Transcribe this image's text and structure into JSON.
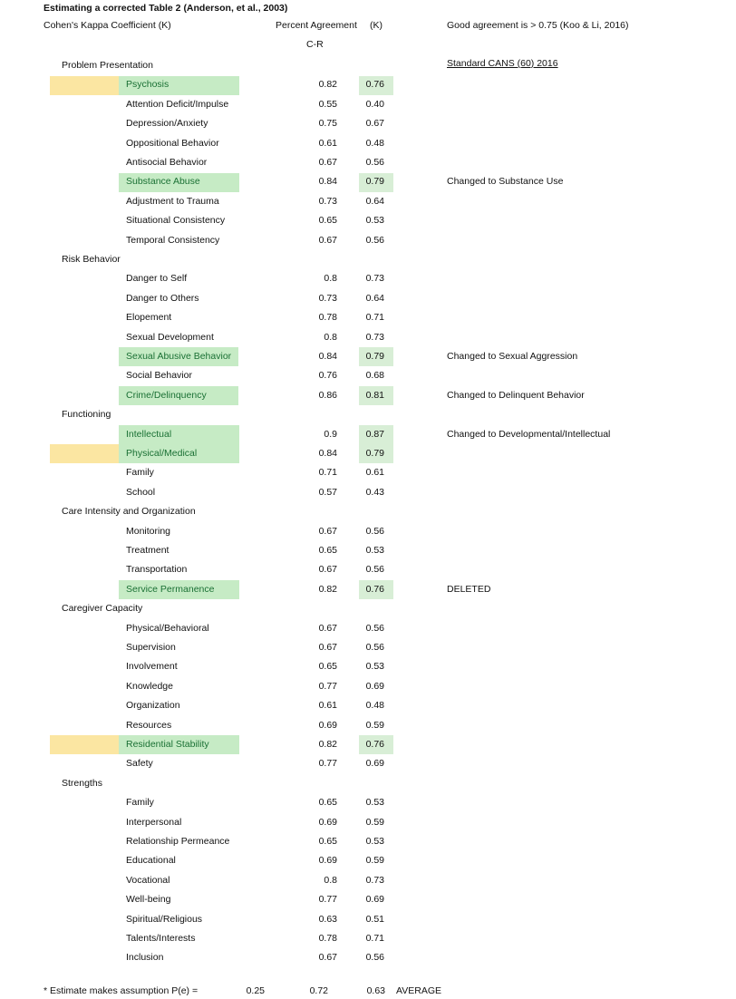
{
  "document": {
    "title": "Estimating a corrected Table 2 (Anderson, et al., 2003)",
    "subtitle": "Cohen's Kappa Coefficient (K)"
  },
  "columns": {
    "percent_agreement": "Percent Agreement",
    "percent_agreement_sub": "C-R",
    "kappa": "(K)"
  },
  "notes": {
    "good_agreement": "Good agreement is > 0.75 (Koo & Li, 2016)",
    "standard_cans": "Standard CANS (60) 2016"
  },
  "footer": {
    "label": "* Estimate makes assumption P(e) =",
    "pe": "0.25",
    "percent_agreement_avg": "0.72",
    "kappa_avg": "0.63",
    "average_label": "AVERAGE"
  },
  "sections": [
    {
      "name": "Problem Presentation",
      "rows": [
        {
          "label": "Psychosis",
          "pa": "0.82",
          "k": "0.76",
          "note": "",
          "highlight": "green",
          "yellow": true
        },
        {
          "label": "Attention Deficit/Impulse",
          "pa": "0.55",
          "k": "0.40",
          "note": "",
          "highlight": "none",
          "yellow": false
        },
        {
          "label": "Depression/Anxiety",
          "pa": "0.75",
          "k": "0.67",
          "note": "",
          "highlight": "none",
          "yellow": false
        },
        {
          "label": "Oppositional Behavior",
          "pa": "0.61",
          "k": "0.48",
          "note": "",
          "highlight": "none",
          "yellow": false
        },
        {
          "label": "Antisocial Behavior",
          "pa": "0.67",
          "k": "0.56",
          "note": "",
          "highlight": "none",
          "yellow": false
        },
        {
          "label": "Substance Abuse",
          "pa": "0.84",
          "k": "0.79",
          "note": "Changed to Substance Use",
          "highlight": "green",
          "yellow": false
        },
        {
          "label": "Adjustment to Trauma",
          "pa": "0.73",
          "k": "0.64",
          "note": "",
          "highlight": "none",
          "yellow": false
        },
        {
          "label": "Situational Consistency",
          "pa": "0.65",
          "k": "0.53",
          "note": "",
          "highlight": "none",
          "yellow": false
        },
        {
          "label": "Temporal Consistency",
          "pa": "0.67",
          "k": "0.56",
          "note": "",
          "highlight": "none",
          "yellow": false
        }
      ]
    },
    {
      "name": "Risk Behavior",
      "rows": [
        {
          "label": "Danger to Self",
          "pa": "0.8",
          "k": "0.73",
          "note": "",
          "highlight": "none",
          "yellow": false
        },
        {
          "label": "Danger to Others",
          "pa": "0.73",
          "k": "0.64",
          "note": "",
          "highlight": "none",
          "yellow": false
        },
        {
          "label": "Elopement",
          "pa": "0.78",
          "k": "0.71",
          "note": "",
          "highlight": "none",
          "yellow": false
        },
        {
          "label": "Sexual Development",
          "pa": "0.8",
          "k": "0.73",
          "note": "",
          "highlight": "none",
          "yellow": false
        },
        {
          "label": "Sexual Abusive Behavior",
          "pa": "0.84",
          "k": "0.79",
          "note": "Changed to Sexual Aggression",
          "highlight": "green",
          "yellow": false
        },
        {
          "label": "Social Behavior",
          "pa": "0.76",
          "k": "0.68",
          "note": "",
          "highlight": "none",
          "yellow": false
        },
        {
          "label": "Crime/Delinquency",
          "pa": "0.86",
          "k": "0.81",
          "note": "Changed to Delinquent Behavior",
          "highlight": "green",
          "yellow": false
        }
      ]
    },
    {
      "name": "Functioning",
      "rows": [
        {
          "label": "Intellectual",
          "pa": "0.9",
          "k": "0.87",
          "note": "Changed to Developmental/Intellectual",
          "highlight": "green",
          "yellow": false
        },
        {
          "label": "Physical/Medical",
          "pa": "0.84",
          "k": "0.79",
          "note": "",
          "highlight": "green",
          "yellow": true
        },
        {
          "label": "Family",
          "pa": "0.71",
          "k": "0.61",
          "note": "",
          "highlight": "none",
          "yellow": false
        },
        {
          "label": "School",
          "pa": "0.57",
          "k": "0.43",
          "note": "",
          "highlight": "none",
          "yellow": false
        }
      ]
    },
    {
      "name": "Care Intensity and Organization",
      "rows": [
        {
          "label": "Monitoring",
          "pa": "0.67",
          "k": "0.56",
          "note": "",
          "highlight": "none",
          "yellow": false
        },
        {
          "label": "Treatment",
          "pa": "0.65",
          "k": "0.53",
          "note": "",
          "highlight": "none",
          "yellow": false
        },
        {
          "label": "Transportation",
          "pa": "0.67",
          "k": "0.56",
          "note": "",
          "highlight": "none",
          "yellow": false
        },
        {
          "label": "Service Permanence",
          "pa": "0.82",
          "k": "0.76",
          "note": "DELETED",
          "highlight": "green",
          "yellow": false
        }
      ]
    },
    {
      "name": "Caregiver Capacity",
      "rows": [
        {
          "label": "Physical/Behavioral",
          "pa": "0.67",
          "k": "0.56",
          "note": "",
          "highlight": "none",
          "yellow": false
        },
        {
          "label": "Supervision",
          "pa": "0.67",
          "k": "0.56",
          "note": "",
          "highlight": "none",
          "yellow": false
        },
        {
          "label": "Involvement",
          "pa": "0.65",
          "k": "0.53",
          "note": "",
          "highlight": "none",
          "yellow": false
        },
        {
          "label": "Knowledge",
          "pa": "0.77",
          "k": "0.69",
          "note": "",
          "highlight": "none",
          "yellow": false
        },
        {
          "label": "Organization",
          "pa": "0.61",
          "k": "0.48",
          "note": "",
          "highlight": "none",
          "yellow": false
        },
        {
          "label": "Resources",
          "pa": "0.69",
          "k": "0.59",
          "note": "",
          "highlight": "none",
          "yellow": false
        },
        {
          "label": "Residential Stability",
          "pa": "0.82",
          "k": "0.76",
          "note": "",
          "highlight": "green",
          "yellow": true
        },
        {
          "label": "Safety",
          "pa": "0.77",
          "k": "0.69",
          "note": "",
          "highlight": "none",
          "yellow": false
        }
      ]
    },
    {
      "name": "Strengths",
      "rows": [
        {
          "label": "Family",
          "pa": "0.65",
          "k": "0.53",
          "note": "",
          "highlight": "none",
          "yellow": false
        },
        {
          "label": "Interpersonal",
          "pa": "0.69",
          "k": "0.59",
          "note": "",
          "highlight": "none",
          "yellow": false
        },
        {
          "label": "Relationship Permeance",
          "pa": "0.65",
          "k": "0.53",
          "note": "",
          "highlight": "none",
          "yellow": false
        },
        {
          "label": "Educational",
          "pa": "0.69",
          "k": "0.59",
          "note": "",
          "highlight": "none",
          "yellow": false
        },
        {
          "label": "Vocational",
          "pa": "0.8",
          "k": "0.73",
          "note": "",
          "highlight": "none",
          "yellow": false
        },
        {
          "label": "Well-being",
          "pa": "0.77",
          "k": "0.69",
          "note": "",
          "highlight": "none",
          "yellow": false
        },
        {
          "label": "Spiritual/Religious",
          "pa": "0.63",
          "k": "0.51",
          "note": "",
          "highlight": "none",
          "yellow": false
        },
        {
          "label": "Talents/Interests",
          "pa": "0.78",
          "k": "0.71",
          "note": "",
          "highlight": "none",
          "yellow": false
        },
        {
          "label": "Inclusion",
          "pa": "0.67",
          "k": "0.56",
          "note": "",
          "highlight": "none",
          "yellow": false
        }
      ]
    }
  ],
  "colors": {
    "highlight_green": "#c6ebc5",
    "highlight_yellow": "#fbe6a2",
    "kappa_cell_green": "#d8eed6",
    "green_text": "#1a7034",
    "text": "#111111"
  }
}
